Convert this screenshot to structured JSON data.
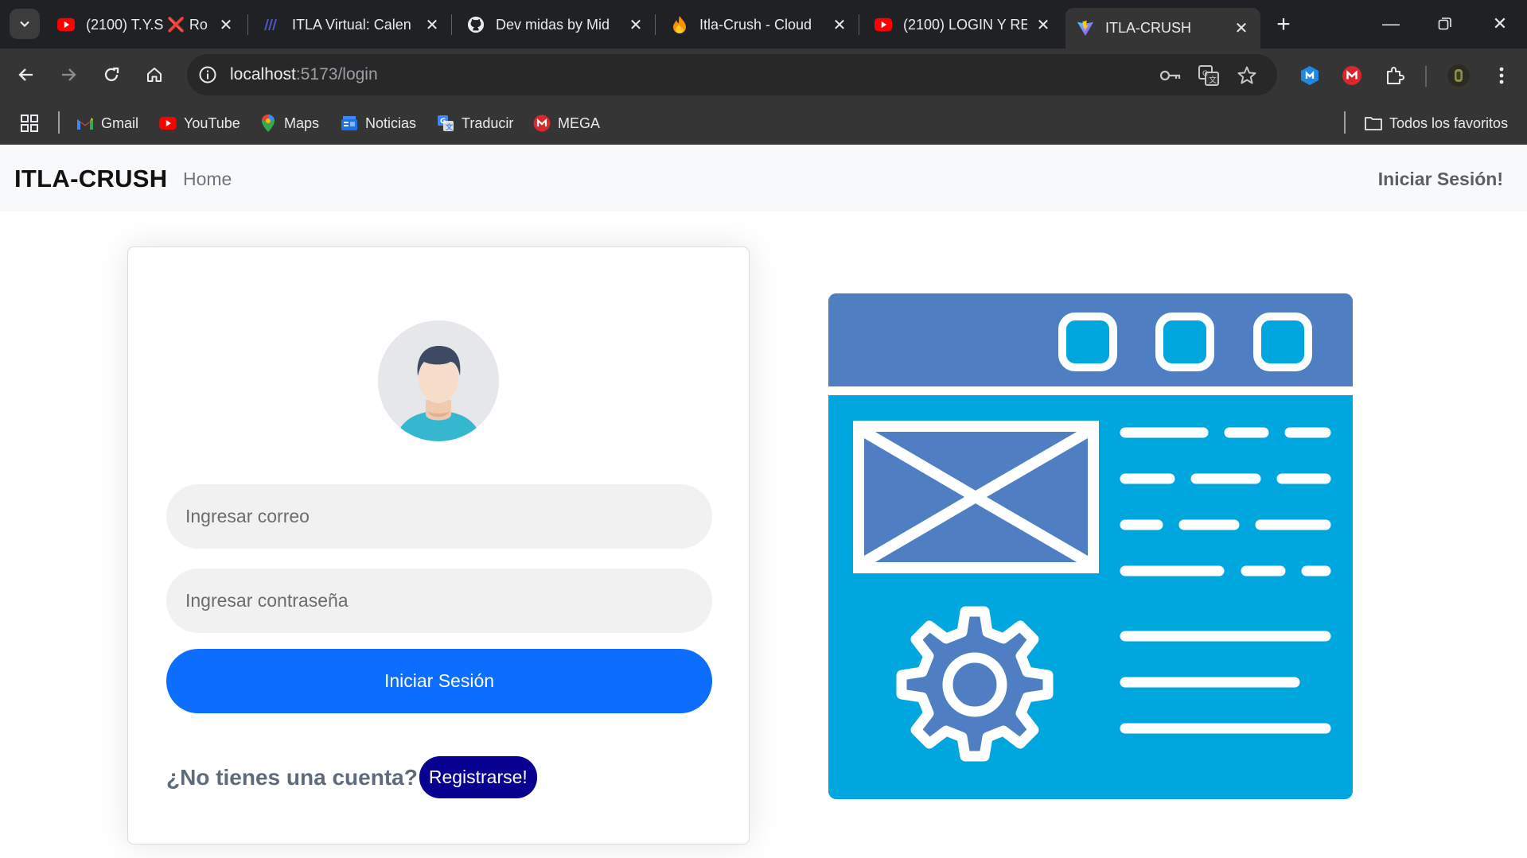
{
  "browser": {
    "tabs": [
      {
        "title": "(2100) T.Y.S ❌ Ro",
        "favicon": "youtube-icon"
      },
      {
        "title": "ITLA Virtual: Calen",
        "favicon": "itla-virtual-icon"
      },
      {
        "title": "Dev midas by Mid",
        "favicon": "github-icon"
      },
      {
        "title": "Itla-Crush - Cloud",
        "favicon": "firebase-icon"
      },
      {
        "title": "(2100) LOGIN Y RE",
        "favicon": "youtube-icon"
      },
      {
        "title": "ITLA-CRUSH",
        "favicon": "vite-icon",
        "active": true
      }
    ],
    "url": {
      "host": "localhost",
      "rest": ":5173/login"
    },
    "bookmarks": [
      {
        "label": "Gmail",
        "icon": "gmail-icon"
      },
      {
        "label": "YouTube",
        "icon": "youtube-icon"
      },
      {
        "label": "Maps",
        "icon": "maps-icon"
      },
      {
        "label": "Noticias",
        "icon": "news-icon"
      },
      {
        "label": "Traducir",
        "icon": "translate-icon"
      },
      {
        "label": "MEGA",
        "icon": "mega-icon"
      }
    ],
    "all_bookmarks_label": "Todos los favoritos"
  },
  "app": {
    "brand": "ITLA-CRUSH",
    "nav_home": "Home",
    "nav_login": "Iniciar Sesión!",
    "form": {
      "email_placeholder": "Ingresar correo",
      "password_placeholder": "Ingresar contraseña",
      "submit_label": "Iniciar Sesión",
      "register_prompt": "¿No tienes una cuenta?",
      "register_button": "Registrarse!"
    }
  },
  "colors": {
    "primary": "#0d6efd",
    "register": "#070090",
    "illustration_dark": "#4f7fc2",
    "illustration_light": "#00a7de"
  }
}
